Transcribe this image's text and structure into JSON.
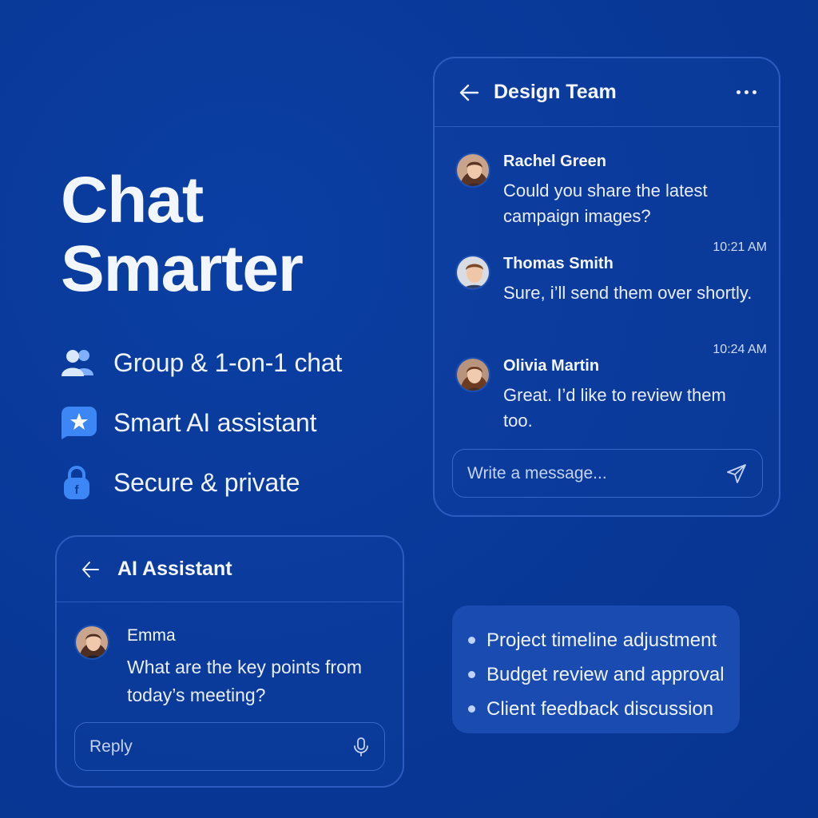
{
  "hero": {
    "line1": "Chat",
    "line2": "Smarter"
  },
  "features": [
    {
      "icon": "users-icon",
      "label": "Group & 1-on-1 chat"
    },
    {
      "icon": "star-badge-icon",
      "label": "Smart AI assistant"
    },
    {
      "icon": "lock-icon",
      "label": "Secure & private"
    }
  ],
  "team_chat": {
    "title": "Design Team",
    "messages": [
      {
        "name": "Rachel Green",
        "text": "Could you share the latest campaign images?",
        "time": ""
      },
      {
        "name": "Thomas Smith",
        "text": "Sure, i’ll send them over shortly.",
        "time": "10:21 AM"
      },
      {
        "name": "Olivia Martin",
        "text": "Great. I’d like to review them too.",
        "time": "10:24 AM"
      }
    ],
    "composer_placeholder": "Write a message..."
  },
  "ai_chat": {
    "title": "AI Assistant",
    "message": {
      "name": "Emma",
      "text": "What are the key points from today’s meeting?"
    },
    "reply_placeholder": "Reply"
  },
  "summary": {
    "items": [
      "Project timeline adjustment",
      "Budget review and approval",
      "Client feedback discussion"
    ]
  },
  "colors": {
    "background": "#0a3b9a",
    "card_border": "#2c5cc0",
    "summary_bg": "#1a4bb0",
    "feature_icon": "#3d86f5"
  }
}
